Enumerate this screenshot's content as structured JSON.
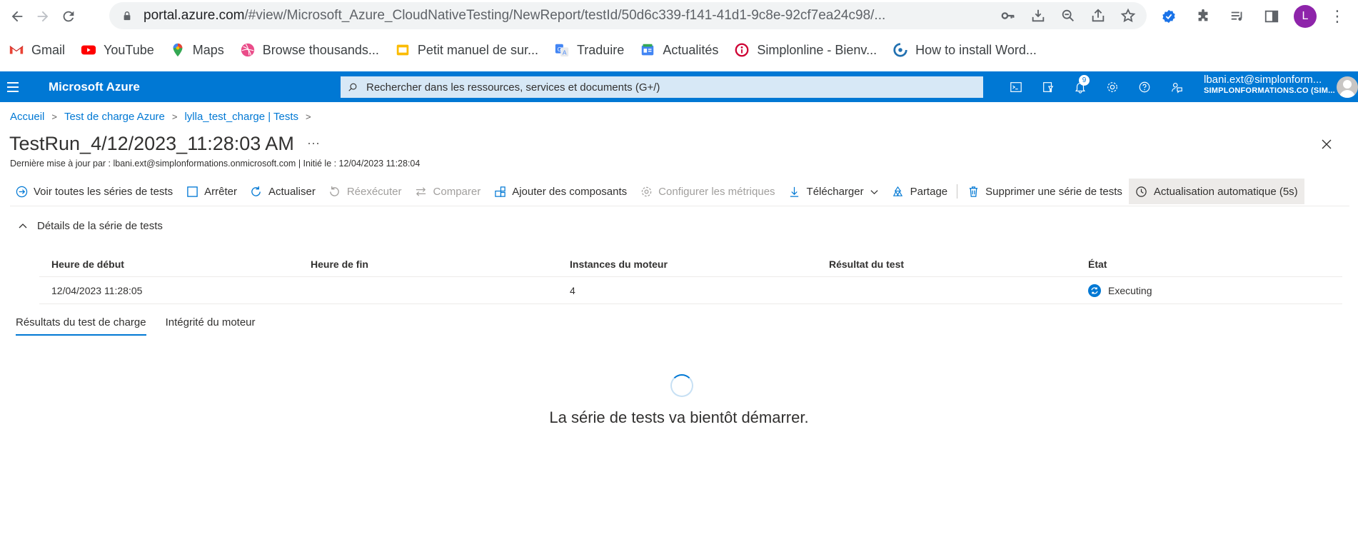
{
  "browser": {
    "url_host": "portal.azure.com",
    "url_path": "/#view/Microsoft_Azure_CloudNativeTesting/NewReport/testId/50d6c339-f141-41d1-9c8e-92cf7ea24c98/...",
    "profile_initial": "L"
  },
  "bookmarks": [
    {
      "label": "Gmail",
      "icon": "gmail-icon"
    },
    {
      "label": "YouTube",
      "icon": "youtube-icon"
    },
    {
      "label": "Maps",
      "icon": "maps-icon"
    },
    {
      "label": "Browse thousands...",
      "icon": "dribbble-icon"
    },
    {
      "label": "Petit manuel de sur...",
      "icon": "slides-icon"
    },
    {
      "label": "Traduire",
      "icon": "translate-icon"
    },
    {
      "label": "Actualités",
      "icon": "news-icon"
    },
    {
      "label": "Simplonline - Bienv...",
      "icon": "simplon-icon"
    },
    {
      "label": "How to install Word...",
      "icon": "wordpress-icon"
    }
  ],
  "azure": {
    "brand": "Microsoft Azure",
    "search_placeholder": "Rechercher dans les ressources, services et documents (G+/)",
    "notification_count": "9",
    "account_email": "lbani.ext@simplonform...",
    "account_tenant": "SIMPLONFORMATIONS.CO (SIM..."
  },
  "breadcrumb": [
    "Accueil",
    "Test de charge Azure",
    "lylla_test_charge | Tests"
  ],
  "page": {
    "title": "TestRun_4/12/2023_11:28:03 AM",
    "more": "···",
    "subtitle": "Dernière mise à jour par : lbani.ext@simplonformations.onmicrosoft.com | Initié le : 12/04/2023 11:28:04"
  },
  "commands": {
    "view_all": "Voir toutes les séries de tests",
    "stop": "Arrêter",
    "refresh": "Actualiser",
    "rerun": "Réexécuter",
    "compare": "Comparer",
    "add_components": "Ajouter des composants",
    "configure_metrics": "Configurer les métriques",
    "download": "Télécharger",
    "share": "Partage",
    "delete_run": "Supprimer une série de tests",
    "auto_refresh": "Actualisation automatique (5s)"
  },
  "details": {
    "section_label": "Détails de la série de tests",
    "columns": [
      "Heure de début",
      "Heure de fin",
      "Instances du moteur",
      "Résultat du test",
      "État"
    ],
    "row": {
      "start": "12/04/2023 11:28:05",
      "end": "",
      "instances": "4",
      "result": "",
      "status": "Executing"
    }
  },
  "tabs": [
    "Résultats du test de charge",
    "Intégrité du moteur"
  ],
  "loading_message": "La série de tests va bientôt démarrer.",
  "colors": {
    "azure_blue": "#0078d4",
    "text": "#323130",
    "disabled": "#a19f9d"
  }
}
